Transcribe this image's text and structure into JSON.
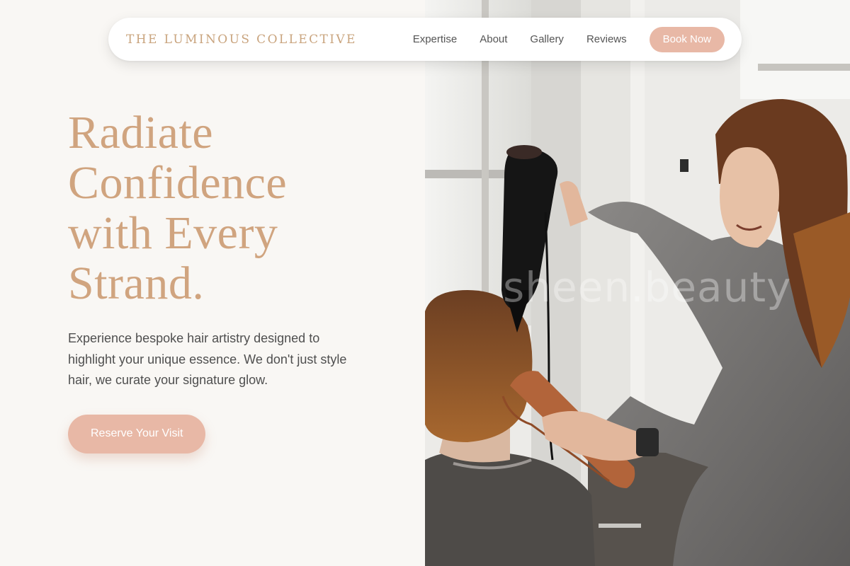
{
  "nav": {
    "brand": "THE LUMINOUS COLLECTIVE",
    "links": [
      "Expertise",
      "About",
      "Gallery",
      "Reviews"
    ],
    "cta_label": "Book Now"
  },
  "hero": {
    "title_lines": [
      "Radiate",
      "Confidence",
      "with Every",
      "Strand."
    ],
    "description": "Experience bespoke hair artistry designed to highlight your unique essence. We don't just style hair, we curate your signature glow.",
    "cta_label": "Reserve Your Visit"
  },
  "image": {
    "watermark": "sheen.beauty"
  },
  "colors": {
    "accent": "#d0a47f",
    "button": "#e8b8a6",
    "background": "#f9f7f4",
    "text": "#4f4f4f"
  }
}
